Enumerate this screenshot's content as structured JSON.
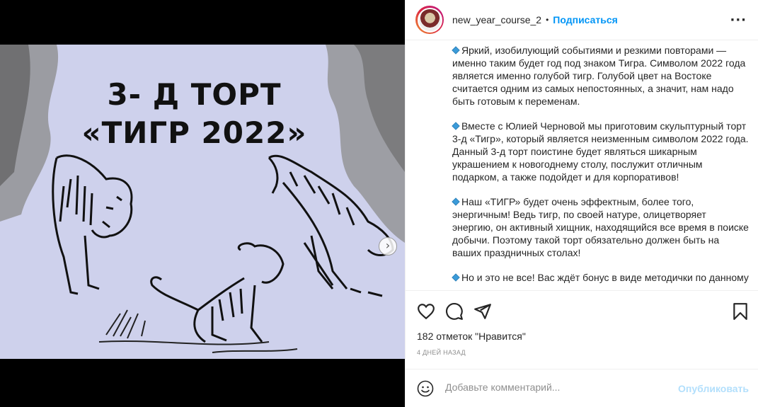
{
  "post": {
    "image": {
      "title_line1": "3- Д ТОРТ",
      "title_line2": "«ТИГР 2022»",
      "background_color": "#ced1ec",
      "next_icon": "chevron-right-icon"
    },
    "header": {
      "username": "new_year_course_2",
      "separator": "•",
      "follow_label": "Подписаться",
      "more_label": "···"
    },
    "caption": [
      "Яркий, изобилующий событиями и резкими повторами — именно таким будет год под знаком Тигра. Символом 2022 года является именно голубой тигр. Голубой цвет на Востоке считается одним из самых непостоянных, а значит, нам надо быть готовым к переменам.",
      "Вместе с Юлией Черновой мы приготовим скульптурный торт 3-д «Тигр», который является неизменным символом 2022 года. Данный 3-д торт поистине будет являться шикарным украшением к новогоднему столу, послужит отличным подарком, а также подойдет и для корпоративов!",
      "Наш «ТИГР» будет очень эффектным, более того, энергичным! Ведь тигр, по своей натуре, олицетворяет энергию, он активный хищник, находящийся все время в поиске добычи. Поэтому такой торт обязательно должен быть на ваших праздничных столах!",
      "Но и это не все! Вас ждёт бонус в виде методички по данному"
    ],
    "actions": {
      "icons": [
        "heart-icon",
        "comment-icon",
        "share-icon",
        "bookmark-icon"
      ]
    },
    "likes_text": "182 отметок \"Нравится\"",
    "timestamp": "4 ДНЕЙ НАЗАД",
    "comment": {
      "placeholder": "Добавьте комментарий...",
      "publish_label": "Опубликовать"
    }
  }
}
